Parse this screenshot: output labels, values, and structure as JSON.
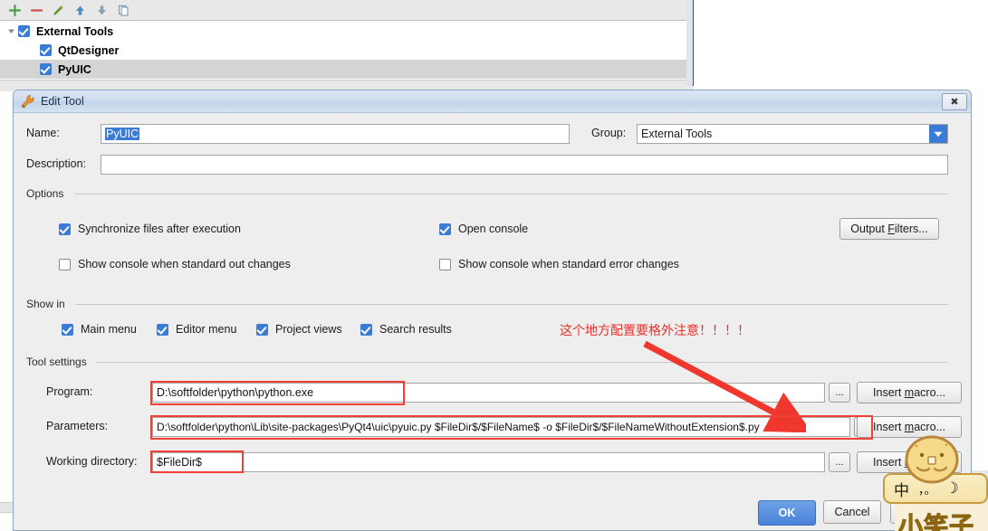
{
  "background": {
    "toolbar_icons": [
      "add-icon",
      "remove-icon",
      "edit-pencil-icon",
      "move-up-icon",
      "move-down-icon",
      "copy-icon"
    ],
    "tree": [
      {
        "label": "External Tools",
        "checked": true,
        "expanded": true,
        "level": 0,
        "selected": false
      },
      {
        "label": "QtDesigner",
        "checked": true,
        "level": 1,
        "selected": false
      },
      {
        "label": "PyUIC",
        "checked": true,
        "level": 1,
        "selected": true
      }
    ]
  },
  "dialog": {
    "title": "Edit Tool",
    "close_label": "✖",
    "name_label": "Name:",
    "name_value": "PyUIC",
    "group_label": "Group:",
    "group_value": "External Tools",
    "description_label": "Description:",
    "description_value": "",
    "options": {
      "legend": "Options",
      "sync_files_label": "Synchronize files after execution",
      "sync_files_checked": true,
      "open_console_label": "Open console",
      "open_console_checked": true,
      "show_console_stdout_label": "Show console when standard out changes",
      "show_console_stdout_checked": false,
      "show_console_stderr_label": "Show console when standard error changes",
      "show_console_stderr_checked": false,
      "output_filters_label": "Output Filters..."
    },
    "show_in": {
      "legend": "Show in",
      "items": [
        {
          "label": "Main menu",
          "checked": true
        },
        {
          "label": "Editor menu",
          "checked": true
        },
        {
          "label": "Project views",
          "checked": true
        },
        {
          "label": "Search results",
          "checked": true
        }
      ]
    },
    "tool_settings": {
      "legend": "Tool settings",
      "program_label": "Program:",
      "program_value": "D:\\softfolder\\python\\python.exe",
      "parameters_label": "Parameters:",
      "parameters_value": "D:\\softfolder\\python\\Lib\\site-packages\\PyQt4\\uic\\pyuic.py  $FileDir$/$FileName$  -o  $FileDir$/$FileNameWithoutExtension$.py",
      "working_dir_label": "Working directory:",
      "working_dir_value": "$FileDir$",
      "browse_label": "...",
      "insert_macro_label": "Insert macro..."
    },
    "buttons": {
      "ok": "OK",
      "cancel": "Cancel",
      "help": "Help"
    }
  },
  "annotation": {
    "text": "这个地方配置要格外注意！！！！",
    "color": "#e8312a",
    "arrow_color": "#f0372e",
    "highlight_rects": [
      "program-field",
      "parameters-field",
      "working-directory-field"
    ]
  },
  "ime_widget": {
    "mode_label": "中",
    "punctuation_label": "，。",
    "moon_label": "☽",
    "skin_text": "小笑子"
  },
  "colors": {
    "accent_blue": "#3a7bd5",
    "ok_blue": "#4a83d8",
    "dialog_bg": "#eeeeee",
    "annotation_red": "#e8312a"
  }
}
